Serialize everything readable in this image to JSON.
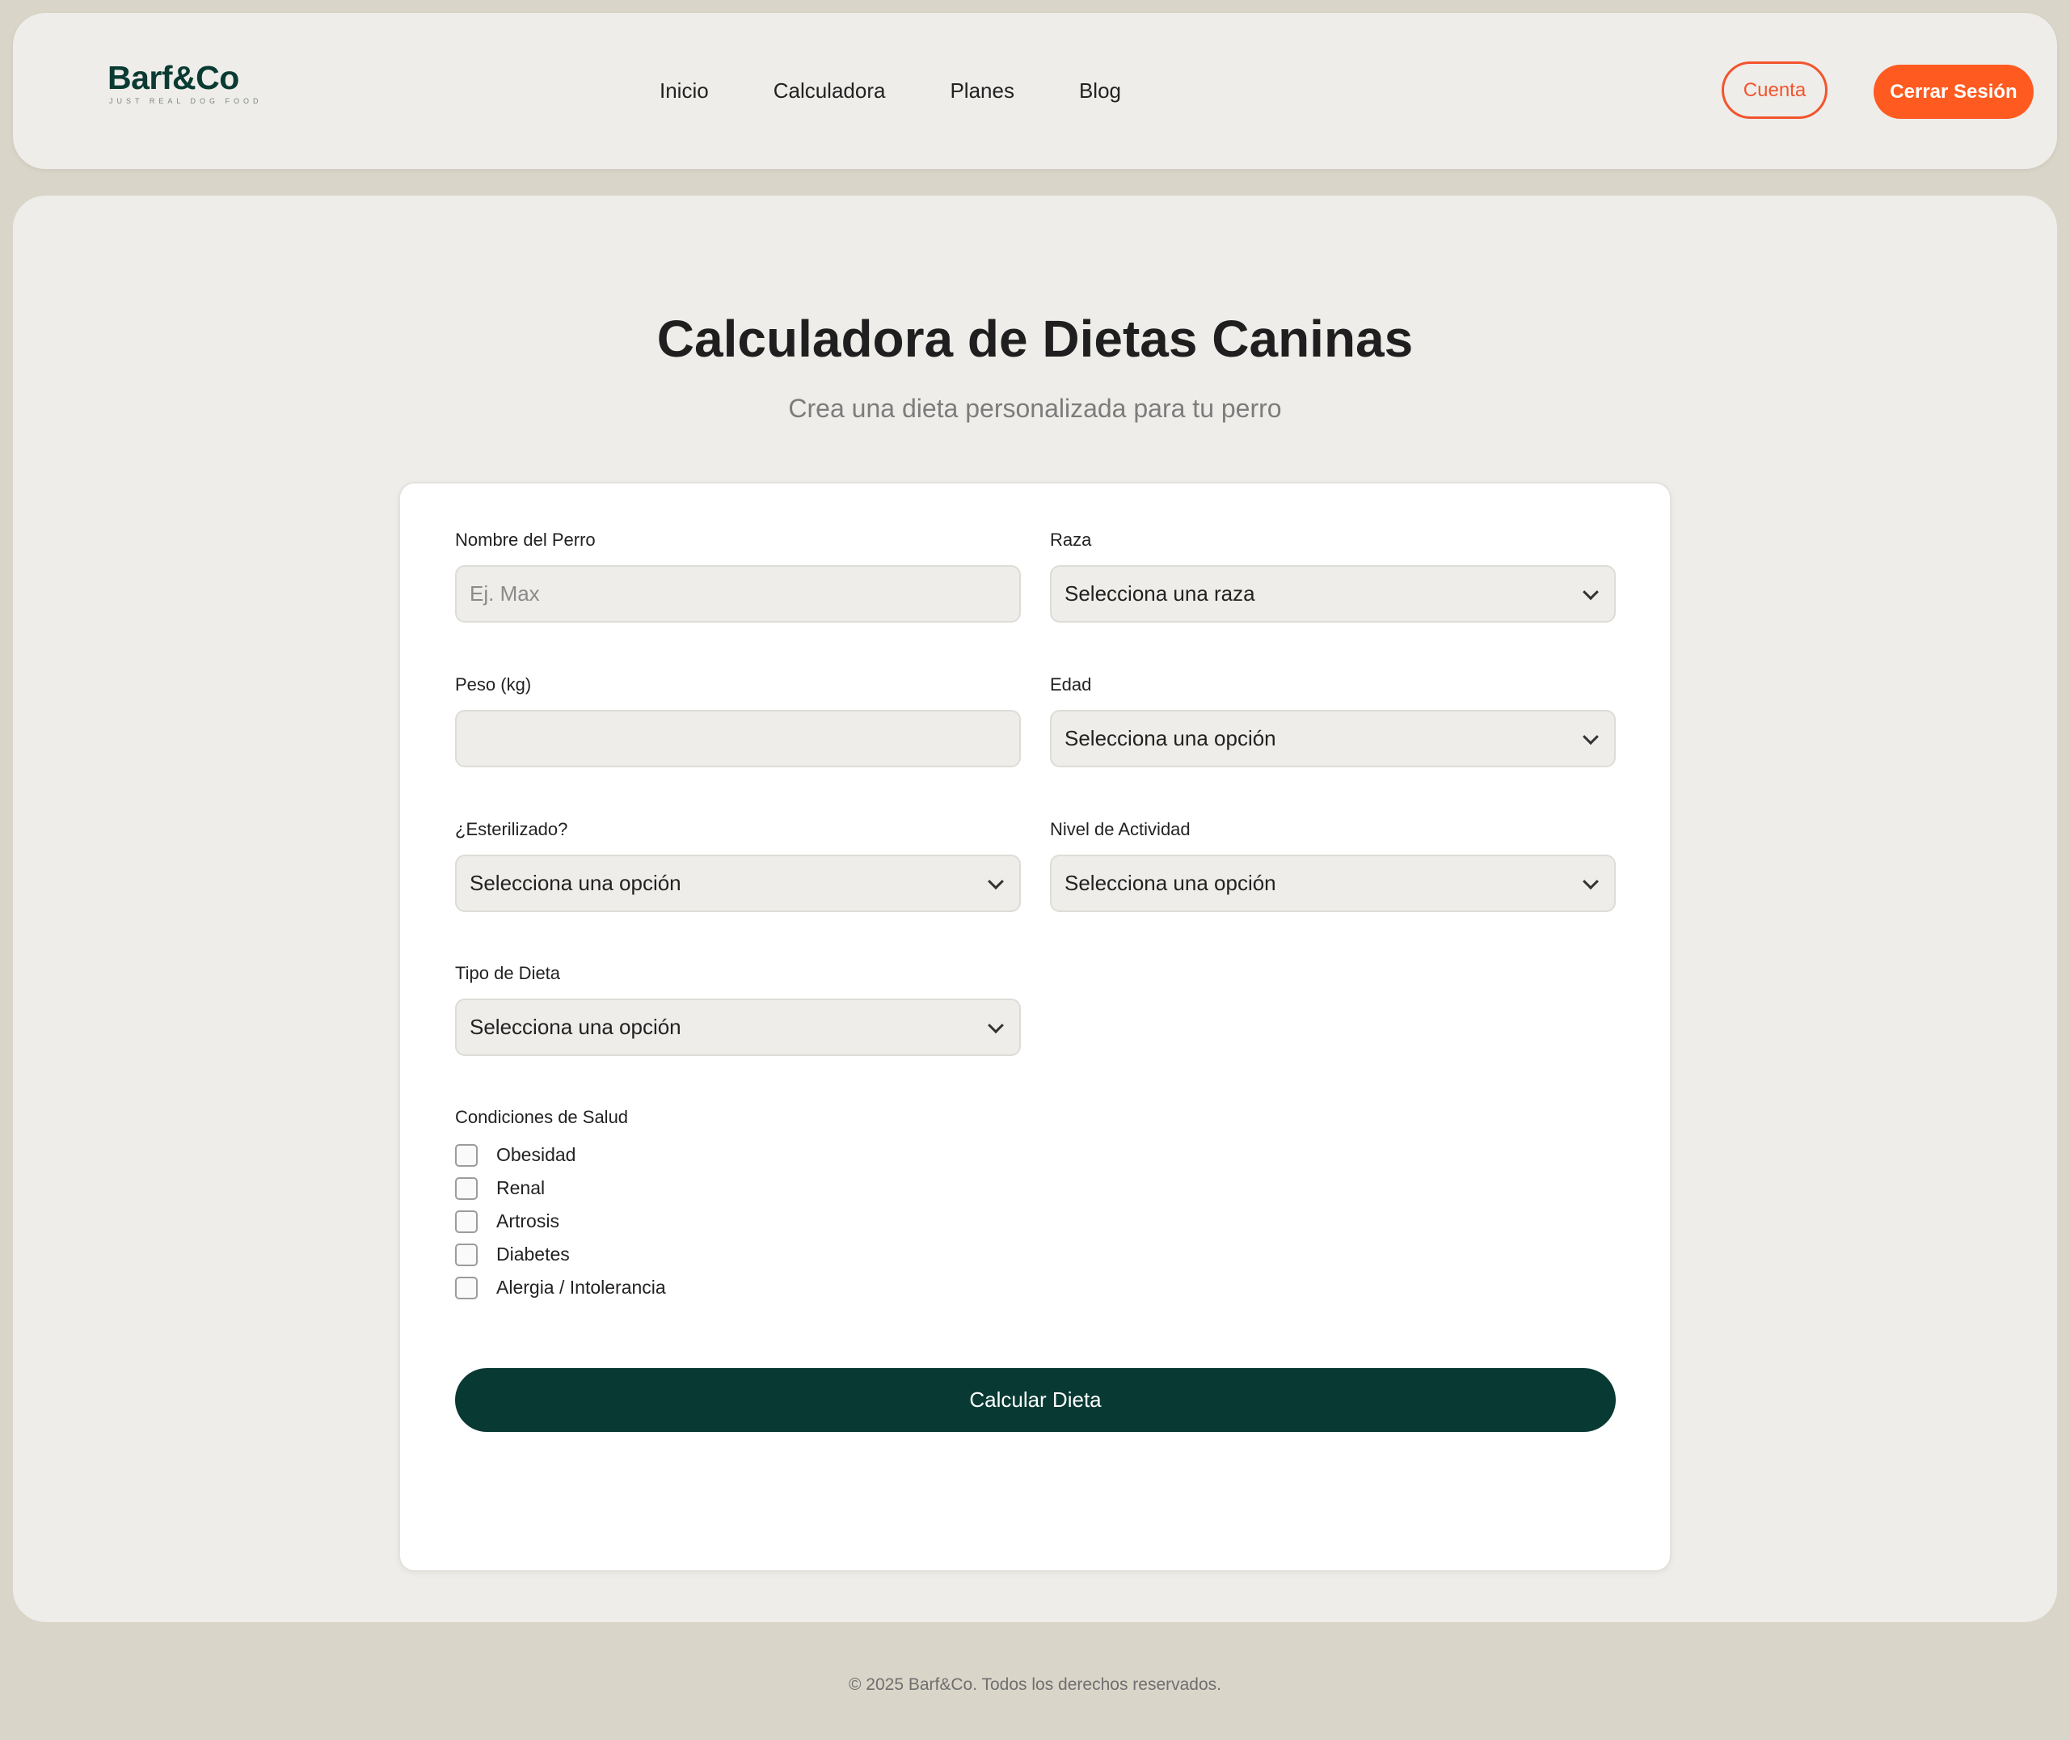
{
  "header": {
    "logo": "Barf&Co",
    "tagline": "JUST REAL DOG FOOD",
    "nav": [
      "Inicio",
      "Calculadora",
      "Planes",
      "Blog"
    ],
    "account_label": "Cuenta",
    "logout_label": "Cerrar Sesión",
    "accent_color": "#ff5a1f",
    "brand_color": "#0a3b33"
  },
  "page": {
    "title": "Calculadora de Dietas Caninas",
    "subtitle": "Crea una dieta personalizada para tu perro"
  },
  "form": {
    "name": {
      "label": "Nombre del Perro",
      "placeholder": "Ej. Max",
      "value": ""
    },
    "breed": {
      "label": "Raza",
      "value": "Selecciona una raza"
    },
    "weight": {
      "label": "Peso (kg)",
      "value": ""
    },
    "age": {
      "label": "Edad",
      "value": "Selecciona una opción"
    },
    "sterilized": {
      "label": "¿Esterilizado?",
      "value": "Selecciona una opción"
    },
    "activity": {
      "label": "Nivel de Actividad",
      "value": "Selecciona una opción"
    },
    "diet_type": {
      "label": "Tipo de Dieta",
      "value": "Selecciona una opción"
    },
    "health": {
      "label": "Condiciones de Salud",
      "options": [
        "Obesidad",
        "Renal",
        "Artrosis",
        "Diabetes",
        "Alergia / Intolerancia"
      ]
    },
    "submit_label": "Calcular Dieta"
  },
  "footer": {
    "text": "© 2025 Barf&Co. Todos los derechos reservados."
  }
}
